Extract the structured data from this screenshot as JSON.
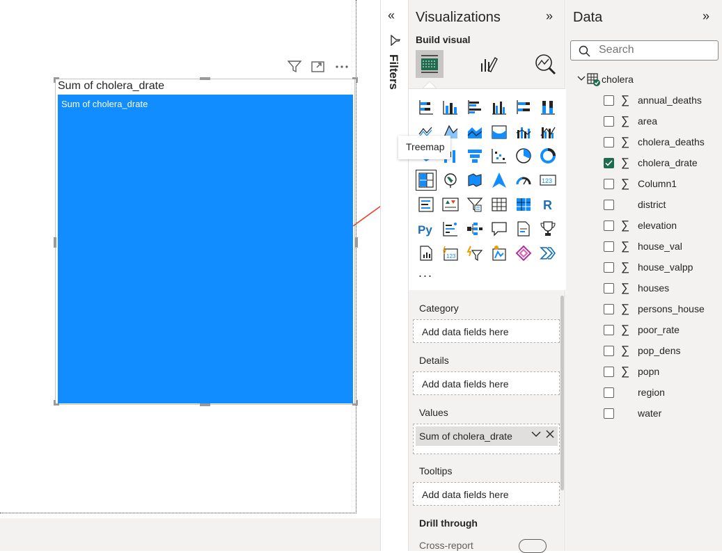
{
  "visual": {
    "title": "Sum of cholera_drate",
    "tile_label": "Sum of cholera_drate",
    "tile_color": "#118dff"
  },
  "filters": {
    "label": "Filters"
  },
  "visualizations": {
    "title": "Visualizations",
    "build_label": "Build visual",
    "tooltip": "Treemap",
    "more": "...",
    "wells": [
      {
        "label": "Category",
        "placeholder": "Add data fields here"
      },
      {
        "label": "Details",
        "placeholder": "Add data fields here"
      },
      {
        "label": "Values",
        "field": "Sum of cholera_drate"
      },
      {
        "label": "Tooltips",
        "placeholder": "Add data fields here"
      }
    ],
    "drill_label": "Drill through",
    "drill_cross": "Cross-report"
  },
  "data_pane": {
    "title": "Data",
    "search_placeholder": "Search",
    "table": "cholera",
    "fields": [
      {
        "name": "annual_deaths",
        "sigma": true,
        "checked": false
      },
      {
        "name": "area",
        "sigma": true,
        "checked": false
      },
      {
        "name": "cholera_deaths",
        "sigma": true,
        "checked": false
      },
      {
        "name": "cholera_drate",
        "sigma": true,
        "checked": true
      },
      {
        "name": "Column1",
        "sigma": true,
        "checked": false
      },
      {
        "name": "district",
        "sigma": false,
        "checked": false
      },
      {
        "name": "elevation",
        "sigma": true,
        "checked": false
      },
      {
        "name": "house_val",
        "sigma": true,
        "checked": false
      },
      {
        "name": "house_valpp",
        "sigma": true,
        "checked": false
      },
      {
        "name": "houses",
        "sigma": true,
        "checked": false
      },
      {
        "name": "persons_house",
        "sigma": true,
        "checked": false
      },
      {
        "name": "poor_rate",
        "sigma": true,
        "checked": false
      },
      {
        "name": "pop_dens",
        "sigma": true,
        "checked": false
      },
      {
        "name": "popn",
        "sigma": true,
        "checked": false
      },
      {
        "name": "region",
        "sigma": false,
        "checked": false
      },
      {
        "name": "water",
        "sigma": false,
        "checked": false
      }
    ]
  },
  "colors": {
    "accent": "#118dff",
    "check": "#1e6b4e",
    "arrow": "#e8412c"
  }
}
